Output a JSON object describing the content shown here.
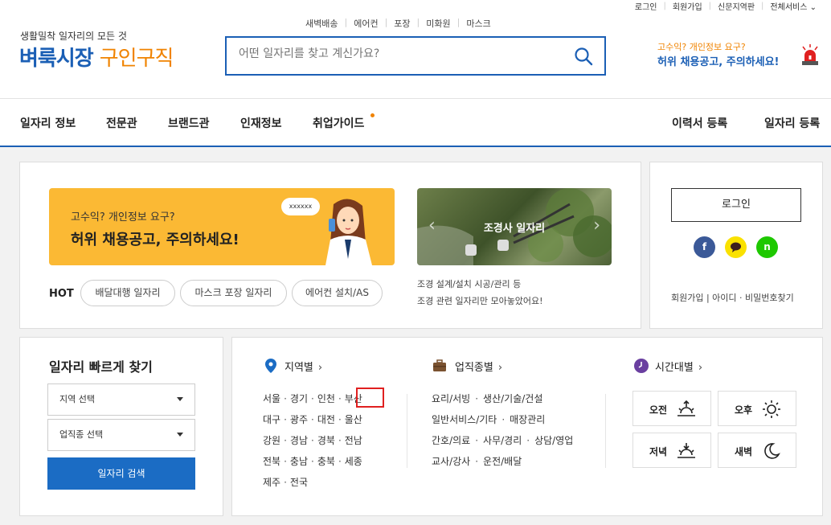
{
  "topnav": {
    "items": [
      "로그인",
      "회원가입",
      "신문지역판",
      "전체서비스"
    ]
  },
  "header": {
    "logo_sub": "생활밀착 일자리의 모든 것",
    "logo_main": "벼룩시장",
    "logo_accent": "구인구직",
    "quick_links": [
      "새벽배송",
      "에어컨",
      "포장",
      "미화원",
      "마스크"
    ],
    "search_placeholder": "어떤 일자리를 찾고 계신가요?",
    "warn_line1": "고수익? 개인정보 요구?",
    "warn_line2": "허위 채용공고, 주의하세요!"
  },
  "gnb": {
    "left": [
      "일자리 정보",
      "전문관",
      "브랜드관",
      "인재정보",
      "취업가이드"
    ],
    "right": [
      "이력서 등록",
      "일자리 등록"
    ]
  },
  "banner": {
    "line1": "고수익? 개인정보 요구?",
    "line2": "허위 채용공고, 주의하세요!",
    "bubble": "xxxxxx"
  },
  "hot": {
    "label": "HOT",
    "tags": [
      "배달대행 일자리",
      "마스크 포장 일자리",
      "에어컨 설치/AS"
    ]
  },
  "photo": {
    "caption": "조경사 일자리",
    "desc1": "조경 설계/설치 시공/관리 등",
    "desc2": "조경 관련 일자리만 모아놓았어요!"
  },
  "login": {
    "button": "로그인",
    "sns": [
      "f",
      "n"
    ],
    "links": "회원가입 | 아이디 · 비밀번호찾기"
  },
  "quick_search": {
    "title": "일자리 빠르게 찾기",
    "region_select": "지역 선택",
    "job_select": "업직종 선택",
    "button": "일자리 검색"
  },
  "region": {
    "title": "지역별",
    "rows": [
      [
        "서울",
        "경기",
        "인천",
        "부산"
      ],
      [
        "대구",
        "광주",
        "대전",
        "울산"
      ],
      [
        "강원",
        "경남",
        "경북",
        "전남"
      ],
      [
        "전북",
        "충남",
        "충북",
        "세종"
      ],
      [
        "제주",
        "전국"
      ]
    ]
  },
  "jobs": {
    "title": "업직종별",
    "rows": [
      [
        "요리/서빙",
        "생산/기술/건설"
      ],
      [
        "일반서비스/기타",
        "매장관리"
      ],
      [
        "간호/의료",
        "사무/경리",
        "상담/영업"
      ],
      [
        "교사/강사",
        "운전/배달"
      ]
    ]
  },
  "time": {
    "title": "시간대별",
    "buttons": [
      "오전",
      "오후",
      "저녁",
      "새벽"
    ]
  },
  "colors": {
    "brand_blue": "#1b5fb5",
    "accent_orange": "#f08300",
    "banner_yellow": "#fbb934",
    "highlight_red": "#e02020"
  }
}
